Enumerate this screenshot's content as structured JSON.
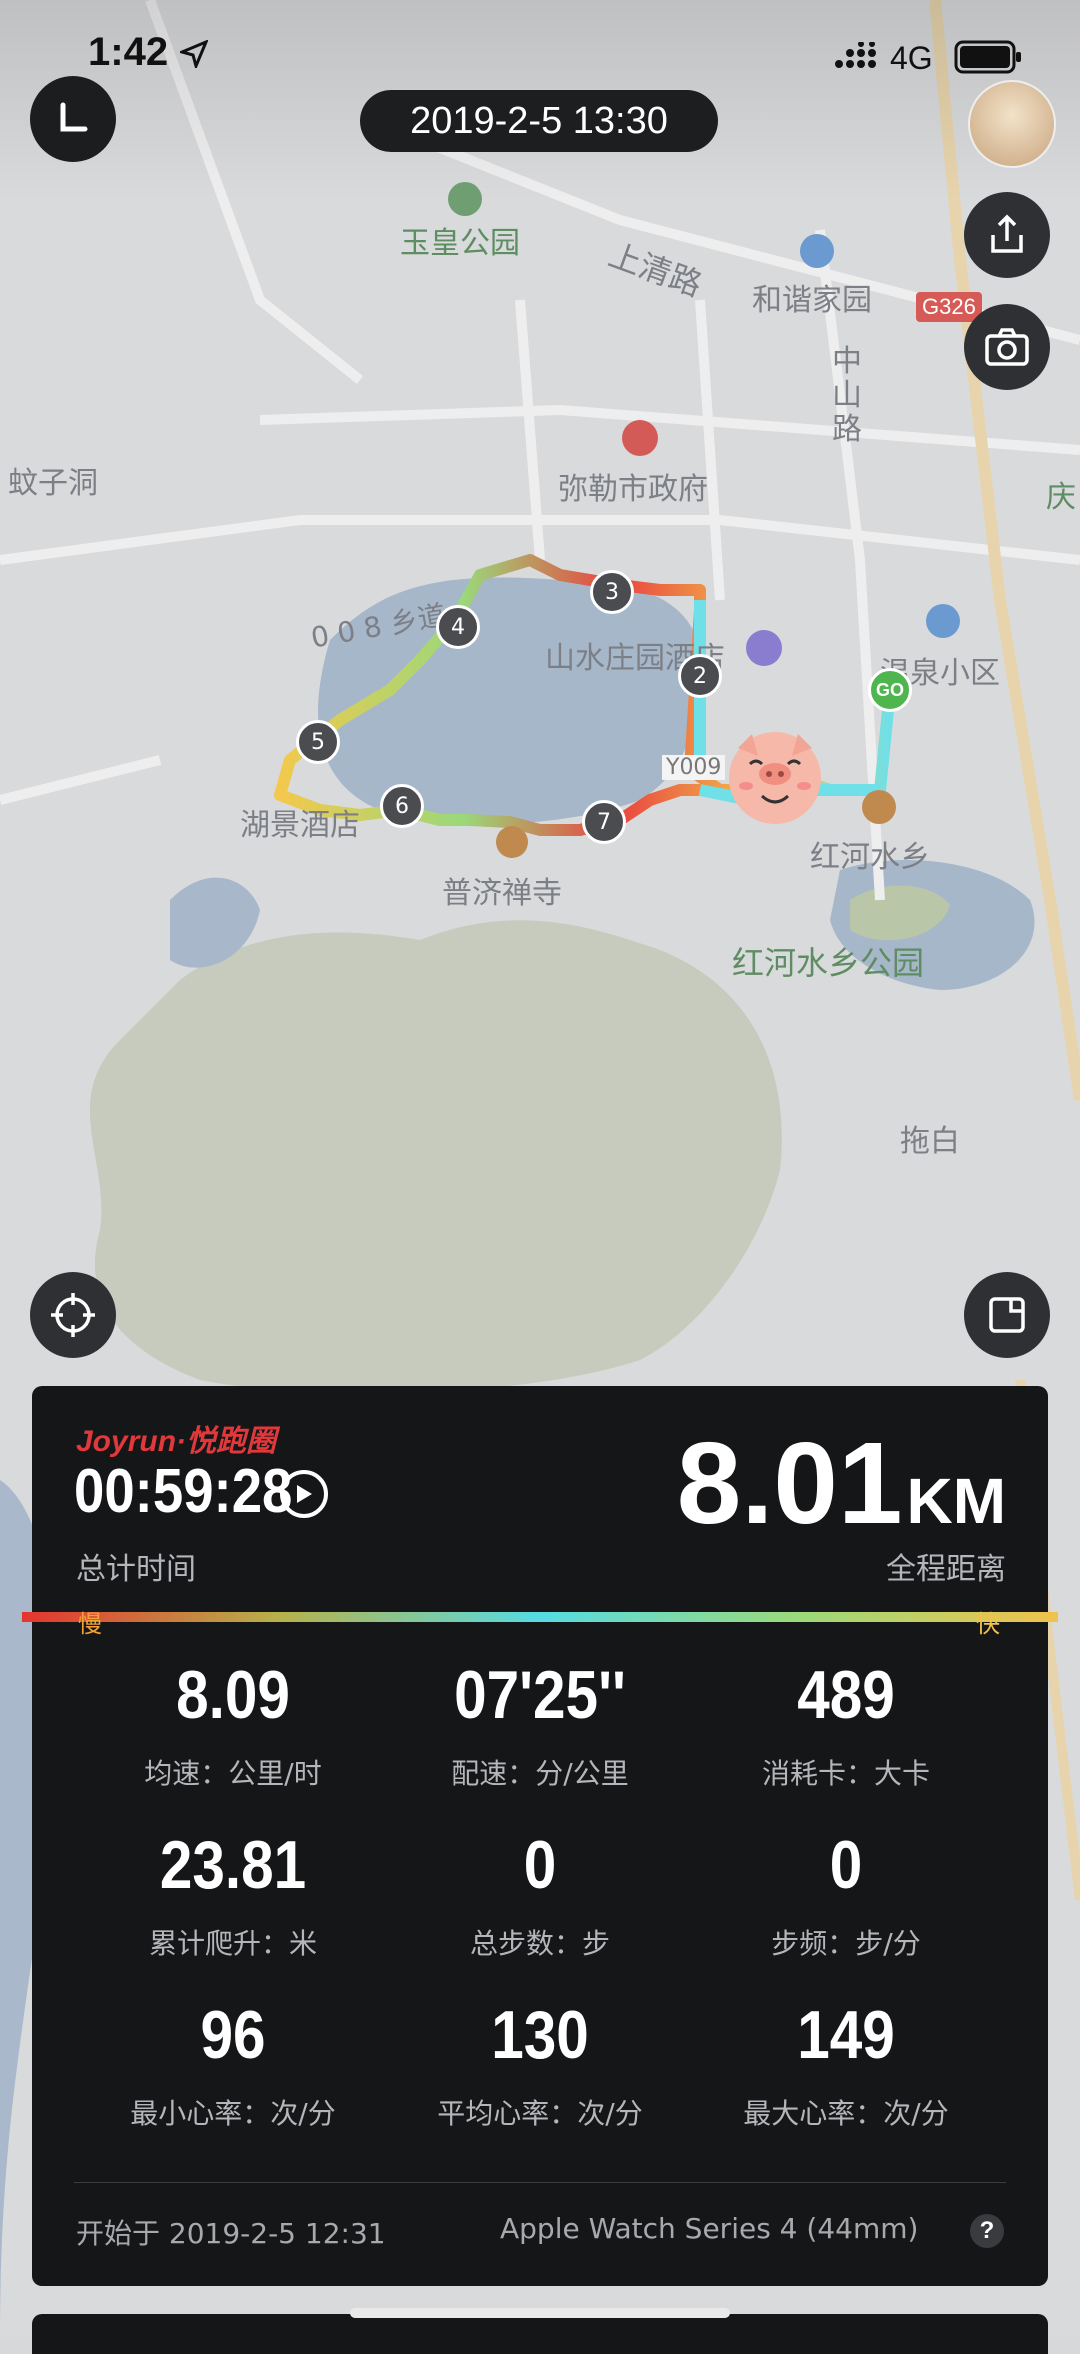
{
  "status_bar": {
    "time": "1:42",
    "network": "4G"
  },
  "header": {
    "date": "2019-2-5 13:30"
  },
  "map": {
    "labels": {
      "yuhuang": "玉皇公园",
      "shangqing": "上清路",
      "hexie": "和谐家园",
      "g326": "G326",
      "zhongshan": "中山路",
      "wenzidong": "蚊子洞",
      "milecity": "弥勒市政府",
      "qing": "庆",
      "road008": "0 0 8 乡道",
      "shanshui": "山水庄园酒店",
      "wenquan": "温泉小区",
      "y009": "Y009",
      "hujing": "湖景酒店",
      "puji": "普济禅寺",
      "honghe": "红河水乡",
      "honghe_park": "红河水乡公园",
      "tuobai": "拖白"
    },
    "km_markers": [
      "2",
      "3",
      "4",
      "5",
      "6",
      "7"
    ],
    "start_marker": "GO"
  },
  "panel": {
    "brand": "Joyrun·悦跑圈",
    "total_time": "00:59:28",
    "total_time_label": "总计时间",
    "distance_value": "8.01",
    "distance_unit": "KM",
    "distance_label": "全程距离",
    "slow_label": "慢",
    "fast_label": "快",
    "stats": [
      {
        "value": "8.09",
        "label": "均速：公里/时"
      },
      {
        "value": "07'25''",
        "label": "配速：分/公里"
      },
      {
        "value": "489",
        "label": "消耗卡：大卡"
      },
      {
        "value": "23.81",
        "label": "累计爬升：米"
      },
      {
        "value": "0",
        "label": "总步数：步"
      },
      {
        "value": "0",
        "label": "步频：步/分"
      },
      {
        "value": "96",
        "label": "最小心率：次/分"
      },
      {
        "value": "130",
        "label": "平均心率：次/分"
      },
      {
        "value": "149",
        "label": "最大心率：次/分"
      }
    ],
    "start_text": "开始于 2019-2-5 12:31",
    "device": "Apple Watch Series 4 (44mm)",
    "help": "?"
  },
  "colors": {
    "panel_bg": "#151618",
    "brand_red": "#e0383b",
    "pill_bg": "#1d1e20"
  }
}
